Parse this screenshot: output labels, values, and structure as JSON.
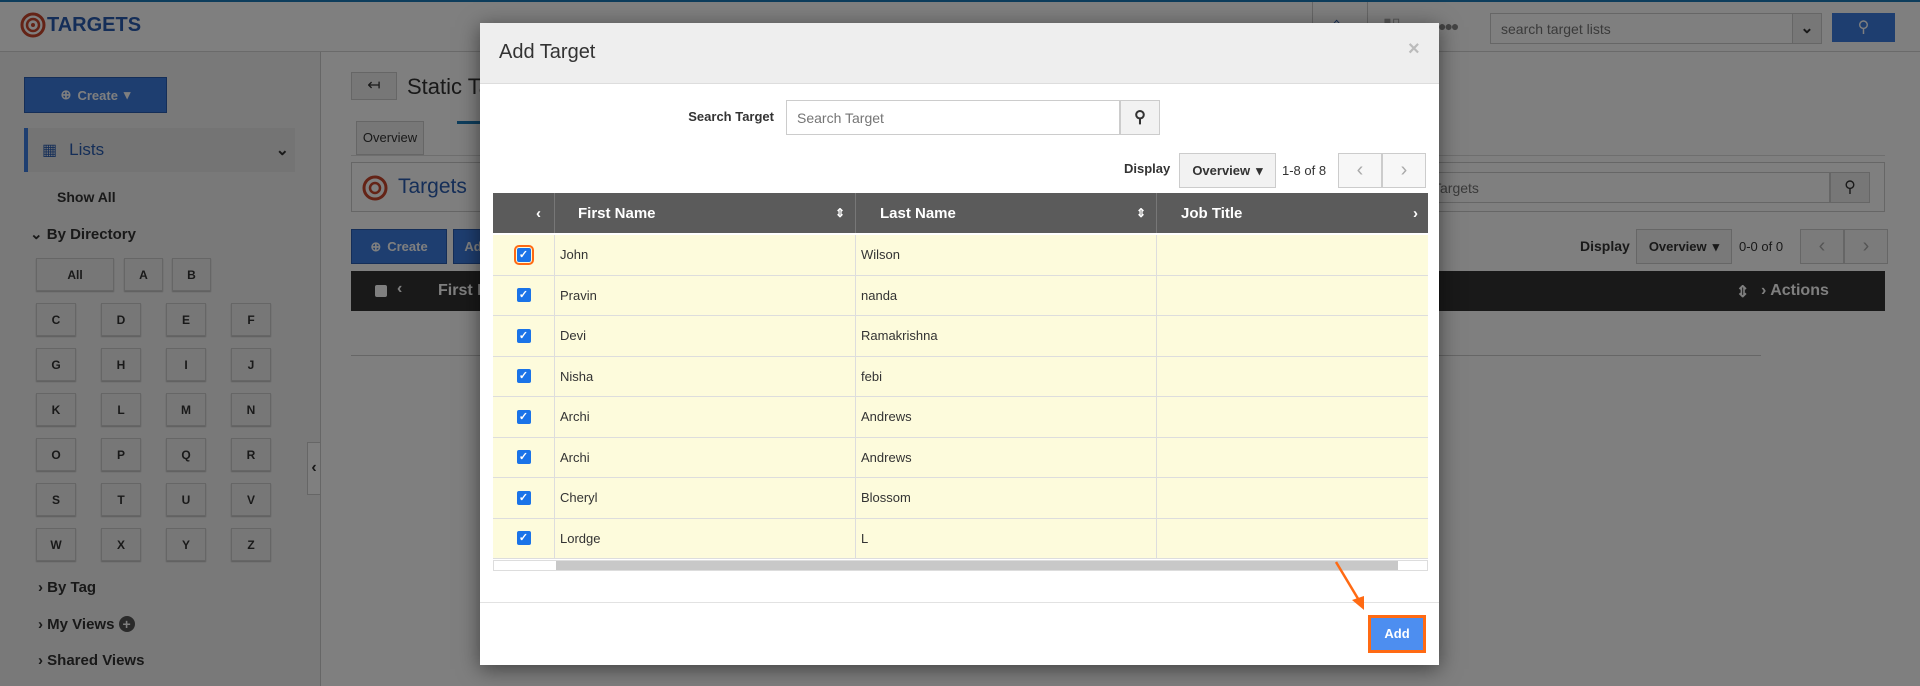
{
  "app": {
    "title": "TARGETS",
    "search_placeholder": "search target lists"
  },
  "sidebar": {
    "create_label": "Create",
    "lists_label": "Lists",
    "show_all": "Show All",
    "by_directory": "By Directory",
    "letters": [
      "All",
      "A",
      "B",
      "C",
      "D",
      "E",
      "F",
      "G",
      "H",
      "I",
      "J",
      "K",
      "L",
      "M",
      "N",
      "O",
      "P",
      "Q",
      "R",
      "S",
      "T",
      "U",
      "V",
      "W",
      "X",
      "Y",
      "Z"
    ],
    "by_tag": "By Tag",
    "my_views": "My Views",
    "shared_views": "Shared Views"
  },
  "main": {
    "page_title": "Static Ta",
    "tab_overview": "Overview",
    "panel_title": "Targets",
    "create_label": "Create",
    "add_label": "Ad",
    "search_placeholder": "Targets",
    "display_label": "Display",
    "display_value": "Overview",
    "range": "0-0 of 0",
    "col_first": "First I",
    "col_actions": "Actions"
  },
  "modal": {
    "title": "Add Target",
    "search_label": "Search Target",
    "search_placeholder": "Search Target",
    "display_label": "Display",
    "display_value": "Overview",
    "range": "1-8 of 8",
    "columns": [
      "First Name",
      "Last Name",
      "Job Title"
    ],
    "rows": [
      {
        "first": "John",
        "last": "Wilson",
        "job": "",
        "checked": true
      },
      {
        "first": "Pravin",
        "last": "nanda",
        "job": "",
        "checked": true
      },
      {
        "first": "Devi",
        "last": "Ramakrishna",
        "job": "",
        "checked": true
      },
      {
        "first": "Nisha",
        "last": "febi",
        "job": "",
        "checked": true
      },
      {
        "first": "Archi",
        "last": "Andrews",
        "job": "",
        "checked": true
      },
      {
        "first": "Archi",
        "last": "Andrews",
        "job": "",
        "checked": true
      },
      {
        "first": "Cheryl",
        "last": "Blossom",
        "job": "",
        "checked": true
      },
      {
        "first": "Lordge",
        "last": "L",
        "job": "",
        "checked": true
      }
    ],
    "add_label": "Add"
  },
  "colors": {
    "accent": "#3d7de0",
    "highlight": "#ff6a13",
    "row_bg": "#fdfbdc"
  }
}
